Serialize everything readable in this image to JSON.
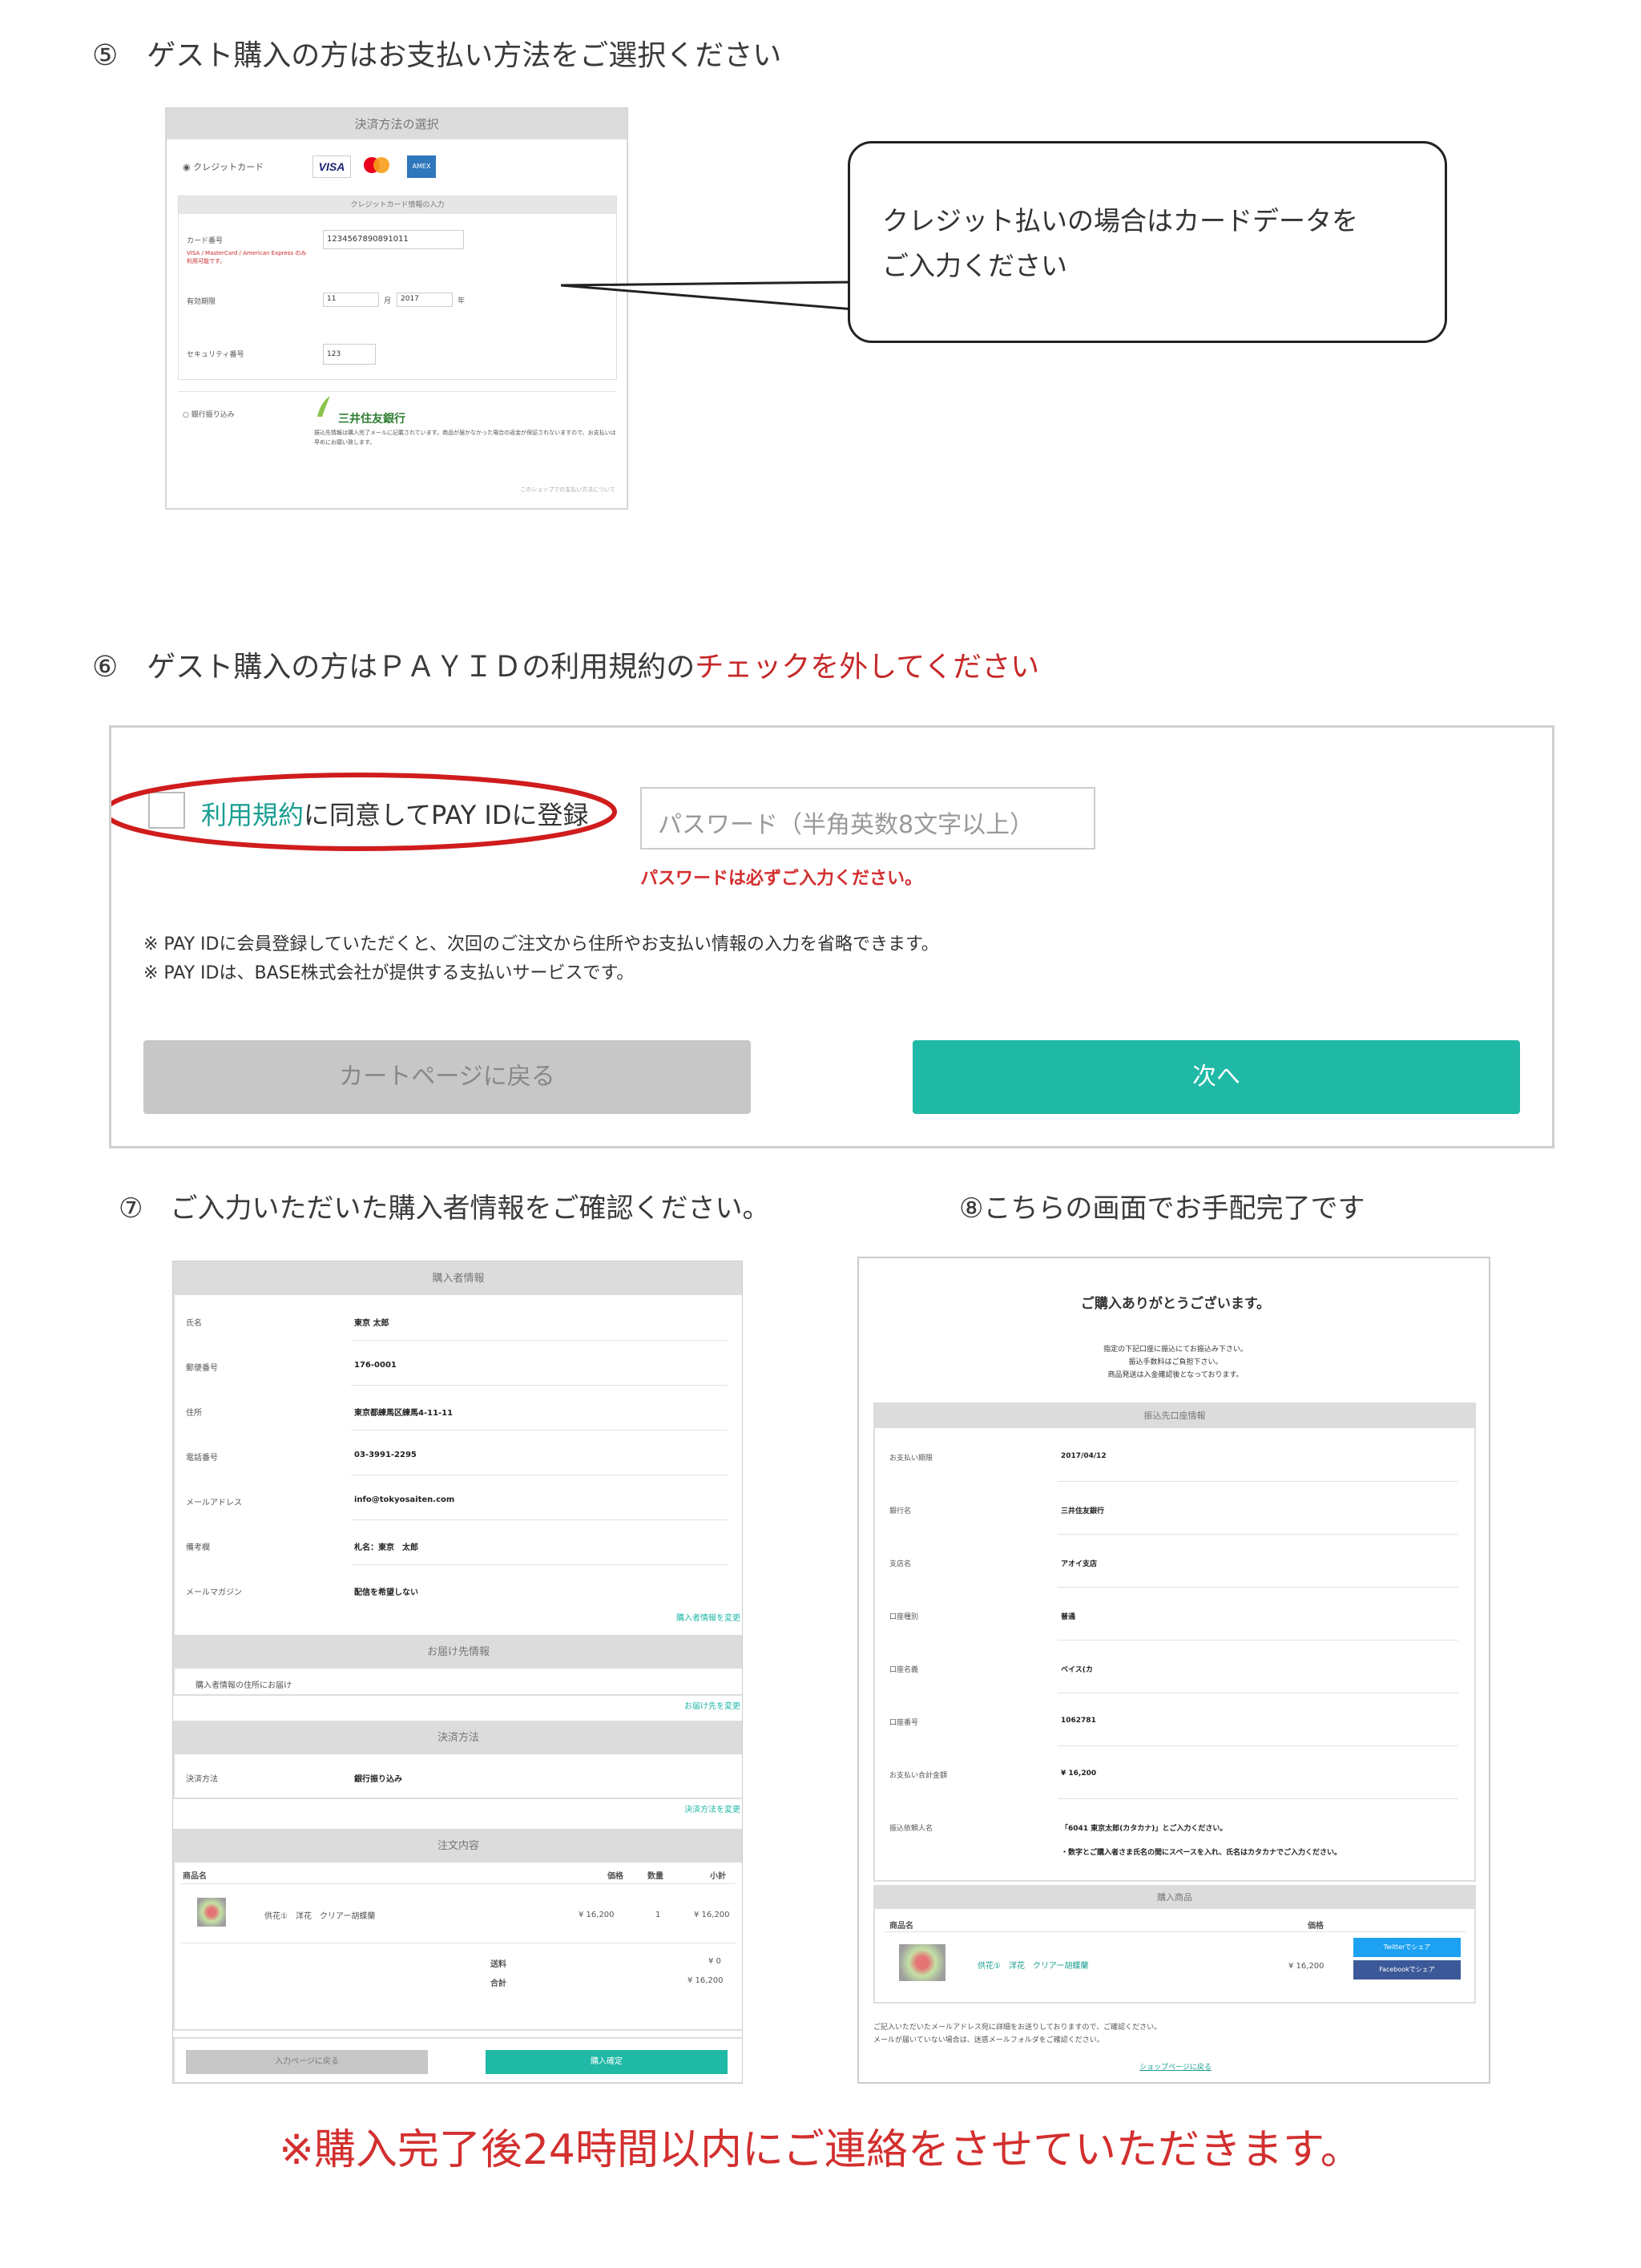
{
  "step5": {
    "heading": "⑤　ゲスト購入の方はお支払い方法をご選択ください",
    "panel_title": "決済方法の選択",
    "credit_radio": "◉ クレジットカード",
    "card_brands": [
      "VISA",
      "mastercard",
      "AMEX"
    ],
    "card_form_title": "クレジットカード情報の入力",
    "card_number_label": "カード番号",
    "card_brand_note": "VISA / MasterCard / American Express のみ利用可能です。",
    "card_number_value": "1234567890891011",
    "expiry_label": "有効期限",
    "expiry_month": "11",
    "month_unit": "月",
    "expiry_year": "2017",
    "year_unit": "年",
    "security_label": "セキュリティ番号",
    "security_value": "123",
    "bank_radio": "○ 銀行振り込み",
    "bank_name": "三井住友銀行",
    "bank_note": "振込先情報は購入完了メールに記載されています。商品が届かなかった場合の返金が保証されないますので、お支払いは早めにお願い致します。",
    "footer_link": "このショップでの支払い方法について",
    "callout": [
      "クレジット払いの場合はカードデータを",
      "ご入力ください"
    ]
  },
  "step6": {
    "heading_prefix": "⑥　ゲスト購入の方はＰＡＹＩＤの利用規約の",
    "heading_red": "チェックを外してください",
    "terms_link": "利用規約",
    "terms_text": "に同意してPAY IDに登録",
    "password_placeholder": "パスワード（半角英数8文字以上）",
    "password_error": "パスワードは必ずご入力ください。",
    "note1": "※ PAY IDに会員登録していただくと、次回のご注文から住所やお支払い情報の入力を省略できます。",
    "note2": "※ PAY IDは、BASE株式会社が提供する支払いサービスです。",
    "back_button": "カートページに戻る",
    "next_button": "次へ"
  },
  "step7": {
    "heading": "⑦　ご入力いただいた購入者情報をご確認ください。",
    "buyer_title": "購入者情報",
    "buyer_rows": [
      {
        "label": "氏名",
        "value": "東京 太郎"
      },
      {
        "label": "郵便番号",
        "value": "176-0001"
      },
      {
        "label": "住所",
        "value": "東京都練馬区練馬4-11-11"
      },
      {
        "label": "電話番号",
        "value": "03-3991-2295"
      },
      {
        "label": "メールアドレス",
        "value": "info@tokyosaiten.com"
      },
      {
        "label": "備考欄",
        "value": "札名：東京　太郎"
      },
      {
        "label": "メールマガジン",
        "value": "配信を希望しない"
      }
    ],
    "buyer_edit": "購入者情報を変更",
    "delivery_title": "お届け先情報",
    "delivery_text": "購入者情報の住所にお届け",
    "delivery_edit": "お届け先を変更",
    "payment_title": "決済方法",
    "payment_label": "決済方法",
    "payment_value": "銀行振り込み",
    "payment_edit": "決済方法を変更",
    "order_title": "注文内容",
    "col_product": "商品名",
    "col_price": "価格",
    "col_qty": "数量",
    "col_subtotal": "小計",
    "item_name": "供花①　洋花　クリアー胡蝶蘭",
    "item_price": "¥ 16,200",
    "item_qty": "1",
    "item_subtotal": "¥ 16,200",
    "shipping_label": "送料",
    "shipping_value": "¥ 0",
    "total_label": "合計",
    "total_value": "¥ 16,200",
    "back_button": "入力ページに戻る",
    "confirm_button": "購入確定"
  },
  "step8": {
    "heading": "⑧こちらの画面でお手配完了です",
    "thanks": "ご購入ありがとうございます。",
    "thanks_lines": [
      "指定の下記口座に振込にてお振込み下さい。",
      "振込手数料はご負担下さい。",
      "商品発送は入金確認後となっております。"
    ],
    "bank_title": "振込先口座情報",
    "bank_rows": [
      {
        "label": "お支払い期限",
        "value": "2017/04/12"
      },
      {
        "label": "銀行名",
        "value": "三井住友銀行"
      },
      {
        "label": "支店名",
        "value": "アオイ支店"
      },
      {
        "label": "口座種別",
        "value": "普通"
      },
      {
        "label": "口座名義",
        "value": "ベイス(カ"
      },
      {
        "label": "口座番号",
        "value": "1062781"
      },
      {
        "label": "お支払い合計金額",
        "value": "¥ 16,200"
      },
      {
        "label": "振込依頼人名",
        "value": "「6041 東京太郎(カタカナ)」とご入力ください。"
      }
    ],
    "bank_note": "・数字とご購入者さま氏名の間にスペースを入れ、氏名はカタカナでご入力ください。",
    "items_title": "購入商品",
    "col_product": "商品名",
    "col_price": "価格",
    "item_name": "供花①　洋花　クリアー胡蝶蘭",
    "item_price": "¥ 16,200",
    "twitter_button": "Twitterでシェア",
    "facebook_button": "Facebookでシェア",
    "mail_note1": "ご記入いただいたメールアドレス宛に詳細をお送りしておりますので、ご確認ください。",
    "mail_note2": "メールが届いていない場合は、迷惑メールフォルダをご確認ください。",
    "shop_link": "ショップページに戻る"
  },
  "footer_notice": "※購入完了後24時間以内にご連絡をさせていただきます。",
  "colors": {
    "teal": "#1fb9a6",
    "red": "#d32f2f",
    "gray_button": "#c7c7c7",
    "twitter": "#1da1f2",
    "facebook": "#3b5998"
  }
}
